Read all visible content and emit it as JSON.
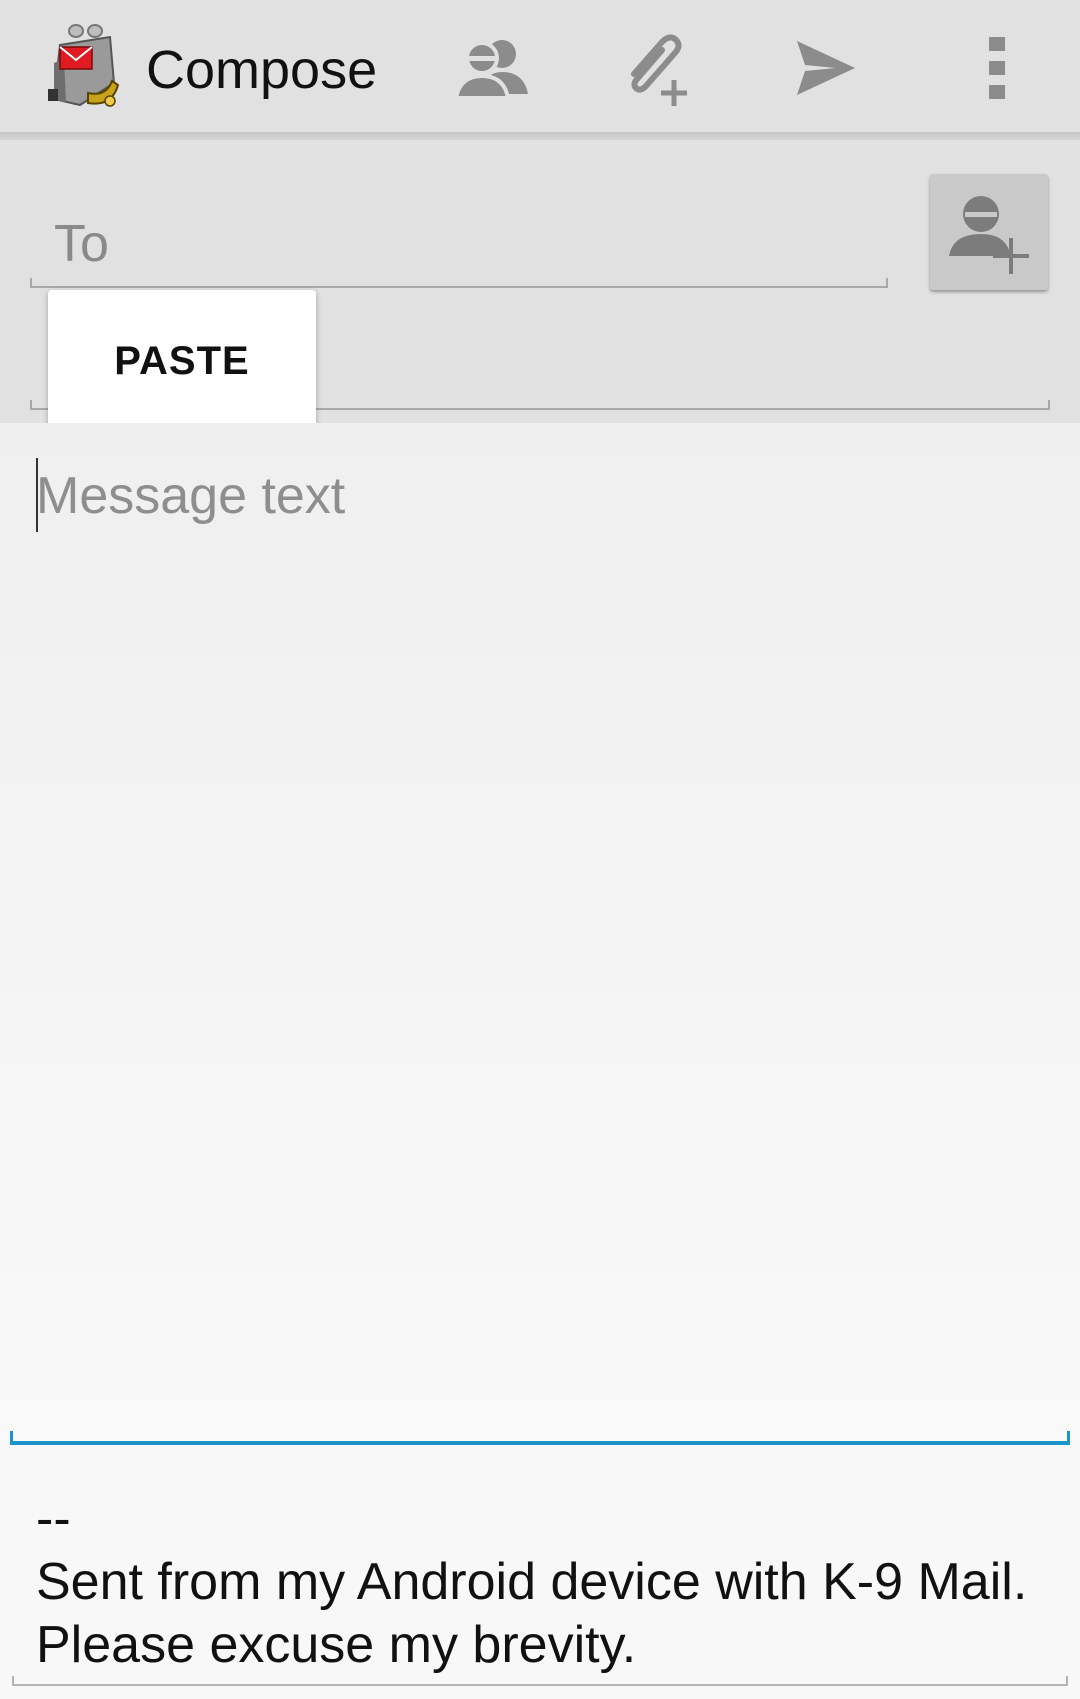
{
  "actionbar": {
    "title": "Compose",
    "icons": [
      "k9-app-icon",
      "contacts-icon",
      "attach-icon",
      "send-icon",
      "overflow-menu-icon"
    ]
  },
  "fields": {
    "to_placeholder": "To"
  },
  "context_menu": {
    "paste_label": "PASTE"
  },
  "message": {
    "placeholder": "Message text"
  },
  "signature": {
    "dashes": "--",
    "text": "Sent from my Android device with K-9 Mail. Please excuse my brevity."
  },
  "colors": {
    "accent": "#1c93c9",
    "actionbar_bg": "#e1e1e1",
    "icon_gray": "#8c8c8c"
  }
}
